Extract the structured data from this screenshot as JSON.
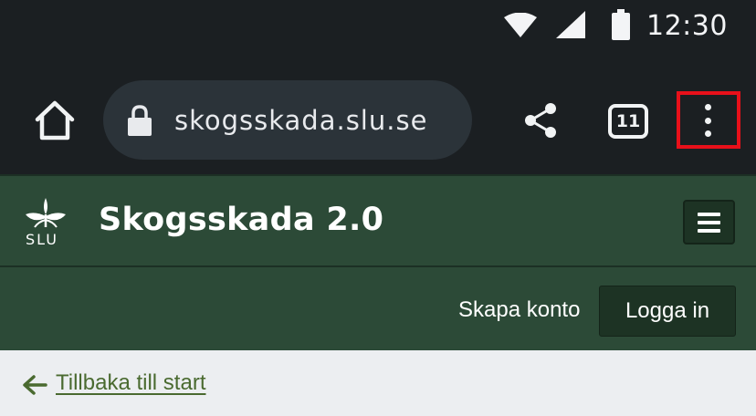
{
  "status_bar": {
    "time": "12:30",
    "icons": [
      "wifi-icon",
      "cell-signal-icon",
      "battery-icon"
    ]
  },
  "browser": {
    "url": "skogsskada.slu.se",
    "tab_count": "11",
    "icons": [
      "home-icon",
      "lock-icon",
      "share-icon",
      "tabs-icon",
      "more-vert-icon"
    ],
    "highlight_color": "#e8101a"
  },
  "site": {
    "logo_text": "SLU",
    "title": "Skogsskada 2.0",
    "header_color": "#2c4a37",
    "create_account_label": "Skapa konto",
    "login_label": "Logga in"
  },
  "page": {
    "back_link_label": "Tillbaka till start",
    "link_color": "#4a6a30"
  }
}
